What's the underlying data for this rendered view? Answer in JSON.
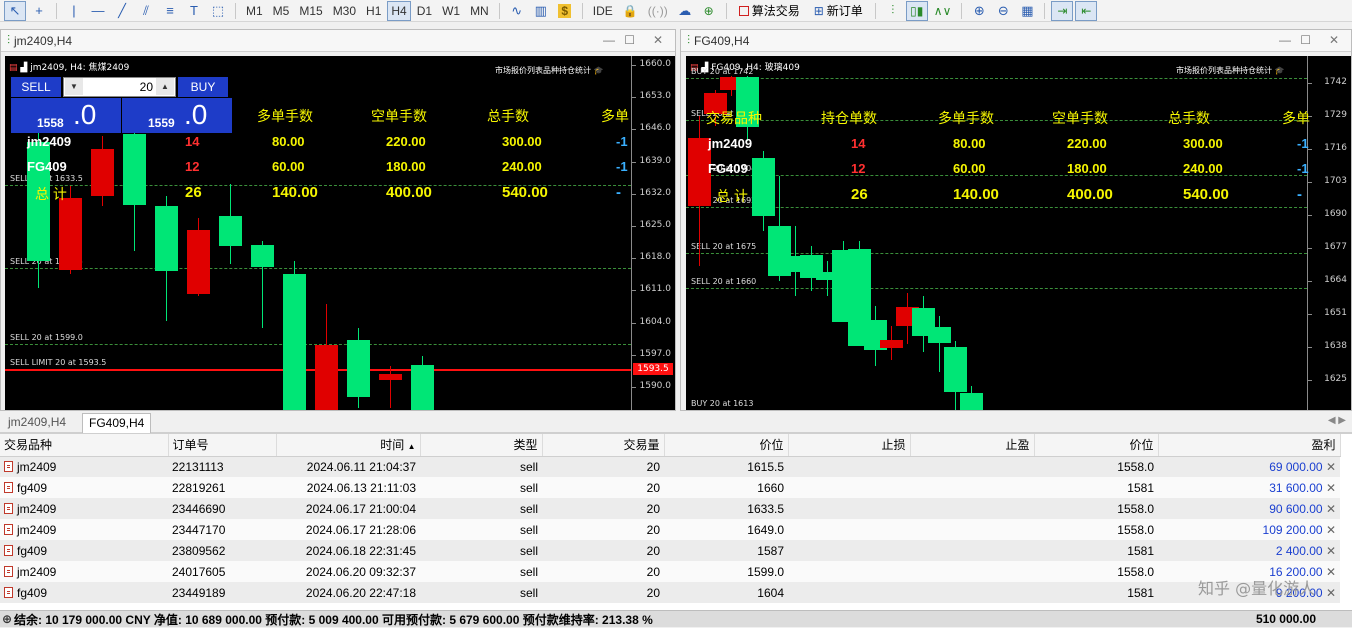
{
  "toolbar": {
    "timeframes": [
      "M1",
      "M5",
      "M15",
      "M30",
      "H1",
      "H4",
      "D1",
      "W1",
      "MN"
    ],
    "active_timeframe": "H4",
    "ide_label": "IDE",
    "algo_label": "算法交易",
    "new_order_label": "新订单"
  },
  "chart1": {
    "window_title": "jm2409,H4",
    "header": "jm2409, H4: 焦煤2409",
    "header_right": "市场报价列表品种持仓统计",
    "sell_label": "SELL",
    "buy_label": "BUY",
    "lot": "20",
    "sell_price_small": "1558",
    "sell_price_big": ".0",
    "buy_price_small": "1559",
    "buy_price_big": ".0",
    "prices": [
      "1660.0",
      "1653.0",
      "1646.0",
      "1639.0",
      "1632.0",
      "1625.0",
      "1618.0",
      "1611.0",
      "1604.0",
      "1597.0",
      "1590.0"
    ],
    "current_price": "1593.5",
    "order_lines": [
      "SELL 20 at 1633.5",
      "SELL 20 at 1615.5",
      "SELL 20 at 1599.0",
      "SELL LIMIT 20 at 1593.5"
    ],
    "table": {
      "headers": [
        "交易品种",
        "持仓单数",
        "多单手数",
        "空单手数",
        "总手数",
        "多单"
      ],
      "rows": [
        {
          "symbol": "jm2409",
          "count": "14",
          "long": "80.00",
          "short": "220.00",
          "total": "300.00",
          "extra": "-1"
        },
        {
          "symbol": "FG409",
          "count": "12",
          "long": "60.00",
          "short": "180.00",
          "total": "240.00",
          "extra": "-1"
        }
      ],
      "total_label": "总 计",
      "total_row": {
        "count": "26",
        "long": "140.00",
        "short": "400.00",
        "total": "540.00",
        "extra": "-"
      }
    }
  },
  "chart2": {
    "window_title": "FG409,H4",
    "header": "FG409, H4: 玻璃409",
    "header_right": "市场报价列表品种持仓统计",
    "prices": [
      "1742",
      "1729",
      "1716",
      "1703",
      "1690",
      "1677",
      "1664",
      "1651",
      "1638",
      "1625"
    ],
    "order_lines": [
      "BUY 20 at 1742",
      "SELL 20 at 1720",
      "SELL 20 at 1704",
      "SELL 20 at 1692",
      "SELL 20 at 1675",
      "SELL 20 at 1660",
      "BUY 20 at 1613"
    ],
    "table": {
      "headers": [
        "交易品种",
        "持仓单数",
        "多单手数",
        "空单手数",
        "总手数",
        "多单"
      ],
      "rows": [
        {
          "symbol": "jm2409",
          "count": "14",
          "long": "80.00",
          "short": "220.00",
          "total": "300.00",
          "extra": "-1"
        },
        {
          "symbol": "FG409",
          "count": "12",
          "long": "60.00",
          "short": "180.00",
          "total": "240.00",
          "extra": "-1"
        }
      ],
      "total_label": "总 计",
      "total_row": {
        "count": "26",
        "long": "140.00",
        "short": "400.00",
        "total": "540.00",
        "extra": "-"
      }
    }
  },
  "tabs": [
    "jm2409,H4",
    "FG409,H4"
  ],
  "active_tab": "FG409,H4",
  "orders": {
    "headers": [
      "交易品种",
      "订单号",
      "时间",
      "类型",
      "交易量",
      "价位",
      "止损",
      "止盈",
      "价位",
      "盈利"
    ],
    "rows": [
      {
        "symbol": "jm2409",
        "ticket": "22131113",
        "time": "2024.06.11 21:04:37",
        "type": "sell",
        "volume": "20",
        "open_price": "1615.5",
        "sl": "",
        "tp": "",
        "price": "1558.0",
        "profit": "69 000.00"
      },
      {
        "symbol": "fg409",
        "ticket": "22819261",
        "time": "2024.06.13 21:11:03",
        "type": "sell",
        "volume": "20",
        "open_price": "1660",
        "sl": "",
        "tp": "",
        "price": "1581",
        "profit": "31 600.00"
      },
      {
        "symbol": "jm2409",
        "ticket": "23446690",
        "time": "2024.06.17 21:00:04",
        "type": "sell",
        "volume": "20",
        "open_price": "1633.5",
        "sl": "",
        "tp": "",
        "price": "1558.0",
        "profit": "90 600.00"
      },
      {
        "symbol": "jm2409",
        "ticket": "23447170",
        "time": "2024.06.17 21:28:06",
        "type": "sell",
        "volume": "20",
        "open_price": "1649.0",
        "sl": "",
        "tp": "",
        "price": "1558.0",
        "profit": "109 200.00"
      },
      {
        "symbol": "fg409",
        "ticket": "23809562",
        "time": "2024.06.18 22:31:45",
        "type": "sell",
        "volume": "20",
        "open_price": "1587",
        "sl": "",
        "tp": "",
        "price": "1581",
        "profit": "2 400.00"
      },
      {
        "symbol": "jm2409",
        "ticket": "24017605",
        "time": "2024.06.20 09:32:37",
        "type": "sell",
        "volume": "20",
        "open_price": "1599.0",
        "sl": "",
        "tp": "",
        "price": "1558.0",
        "profit": "16 200.00"
      },
      {
        "symbol": "fg409",
        "ticket": "23449189",
        "time": "2024.06.20 22:47:18",
        "type": "sell",
        "volume": "20",
        "open_price": "1604",
        "sl": "",
        "tp": "",
        "price": "1581",
        "profit": "9 200.00"
      }
    ]
  },
  "status": {
    "text": "结余: 10 179 000.00 CNY  净值: 10 689 000.00  预付款: 5 009 400.00  可用预付款: 5 679 600.00  预付款维持率: 213.38 %",
    "total_profit": "510 000.00"
  },
  "watermark": "知乎 @量化游人",
  "colors": {
    "bull": "#00e676",
    "bear": "#e00000",
    "accent_blue": "#1e3cc8",
    "profit_blue": "#1a3fd0",
    "text_yellow": "#f5f500"
  }
}
